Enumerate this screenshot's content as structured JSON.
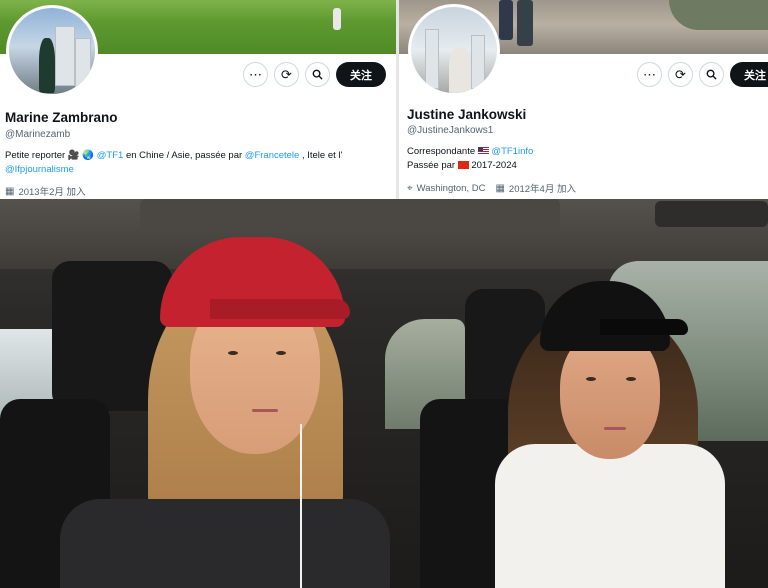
{
  "profiles": [
    {
      "name": "Marine Zambrano",
      "handle": "@Marinezamb",
      "bio_prefix": "Petite reporter 🎥 🌏 ",
      "bio_link1": "@TF1",
      "bio_mid": " en Chine / Asie, passée par ",
      "bio_link2": "@Francetele",
      "bio_mid2": " , Itele et l'",
      "bio_link3": "@Ifpjournalisme",
      "joined": "2013年2月 加入",
      "follow_label": "关注",
      "more_icon": "more-icon",
      "subscribe_icon": "subscribe-icon",
      "search_icon": "search-icon"
    },
    {
      "name": "Justine Jankowski",
      "handle": "@JustineJankows1",
      "role": "Correspondante ",
      "role_link": "@TF1info",
      "passed": "Passée par ",
      "passed_years": " 2017-2024",
      "location": "Washington, DC",
      "joined": "2012年4月 加入",
      "follow_label": "关注"
    }
  ],
  "colors": {
    "link": "#1d9bf0",
    "follow_bg": "#0f1419",
    "cap_red": "#c4222e",
    "cap_black": "#111111"
  }
}
